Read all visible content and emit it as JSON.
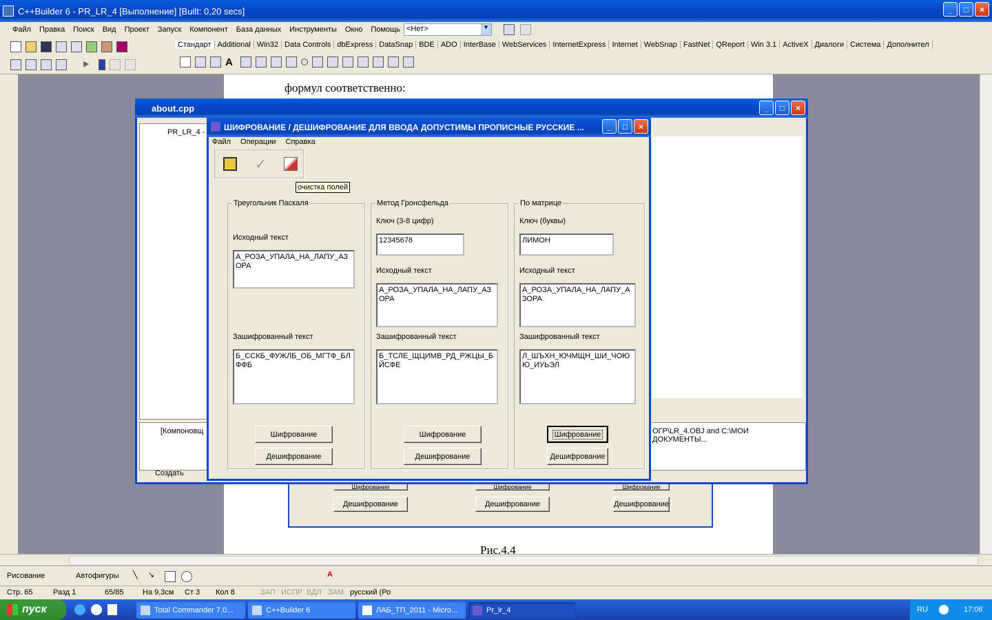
{
  "ide": {
    "title": "C++Builder 6 - PR_LR_4 [Выполнение] [Built: 0,20 secs]",
    "menu": [
      "Файл",
      "Правка",
      "Поиск",
      "Вид",
      "Проект",
      "Запуск",
      "Компонент",
      "База данных",
      "Инструменты",
      "Окно",
      "Помощь"
    ],
    "combo": "<Нет>",
    "palette_tabs": [
      "Стандарт",
      "Additional",
      "Win32",
      "Data Controls",
      "dbExpress",
      "DataSnap",
      "BDE",
      "ADO",
      "InterBase",
      "WebServices",
      "InternetExpress",
      "Internet",
      "WebSnap",
      "FastNet",
      "QReport",
      "Win 3.1",
      "ActiveX",
      "Диалоги",
      "Система",
      "Дополнител"
    ]
  },
  "doc": {
    "line": "формул соответственно:",
    "caption": "Рис.4.4",
    "bg_buttons": [
      "Шифрование",
      "Шифрование",
      "Шифрование"
    ],
    "bg_buttons2": [
      "Дешифрование",
      "Дешифрование",
      "Дешифрование"
    ]
  },
  "editor": {
    "title": "about.cpp",
    "tree_item": "PR_LR_4 -",
    "msg_item": "[Компоновщ",
    "msg_text": "ОГР\\LR_4.OBJ and C:\\МОИ ДОКУМЕНТЫ...",
    "tab": "Создать"
  },
  "app": {
    "title": "ШИФРОВАНИЕ / ДЕШИФРОВАНИЕ    ДЛЯ ВВОДА ДОПУСТИМЫ ПРОПИСНЫЕ РУССКИЕ ...",
    "menu": [
      "Файл",
      "Операции",
      "Справка"
    ],
    "tooltip": "очистка полей",
    "g1": {
      "title": "Треугольник Паскаля",
      "src_label": "Исходный текст",
      "src": "А_РОЗА_УПАЛА_НА_ЛАПУ_АЗОРА",
      "enc_label": "Зашифрованный текст",
      "enc": "Б_ССКБ_ФУЖЛБ_ОБ_МГТФ_БЛФФБ",
      "b1": "Шифрование",
      "b2": "Дешифрование"
    },
    "g2": {
      "title": "Метод Гронсфельда",
      "key_label": "Ключ (3-8 цифр)",
      "key": "12345678",
      "src_label": "Исходный текст",
      "src": "А_РОЗА_УПАЛА_НА_ЛАПУ_АЗОРА",
      "enc_label": "Зашифрованный текст",
      "enc": "Б_ТСЛЕ_ЩЦИМВ_РД_РЖЦЫ_БЙСФЕ",
      "b1": "Шифрование",
      "b2": "Дешифрование"
    },
    "g3": {
      "title": "По матрице",
      "key_label": "Ключ (буквы)",
      "key": "ЛИМОН",
      "src_label": "Исходный текст",
      "src": "А_РОЗА_УПАЛА_НА_ЛАПУ_АЗОРА",
      "enc_label": "Зашифрованный текст",
      "enc": "Л_ШЪХН_ЮЧМЩН_ШИ_ЧОЮЮ_ИУЬЭЛ",
      "b1": "Шифрование",
      "b2": "Дешифрование"
    }
  },
  "word": {
    "draw": "Рисование",
    "autoshapes": "Автофигуры",
    "status": [
      "Стр. 65",
      "Разд 1",
      "65/85",
      "На 9,3см",
      "Ст 3",
      "Кол 8",
      "ЗАП",
      "ИСПР",
      "ВДЛ",
      "ЗАМ",
      "русский (Ро"
    ]
  },
  "taskbar": {
    "start": "пуск",
    "items": [
      "Total Commander 7.0...",
      "C++Builder 6",
      "ЛАБ_ТП_2011 - Micro...",
      "Pr_lr_4"
    ],
    "lang": "RU",
    "time": "17:06"
  }
}
